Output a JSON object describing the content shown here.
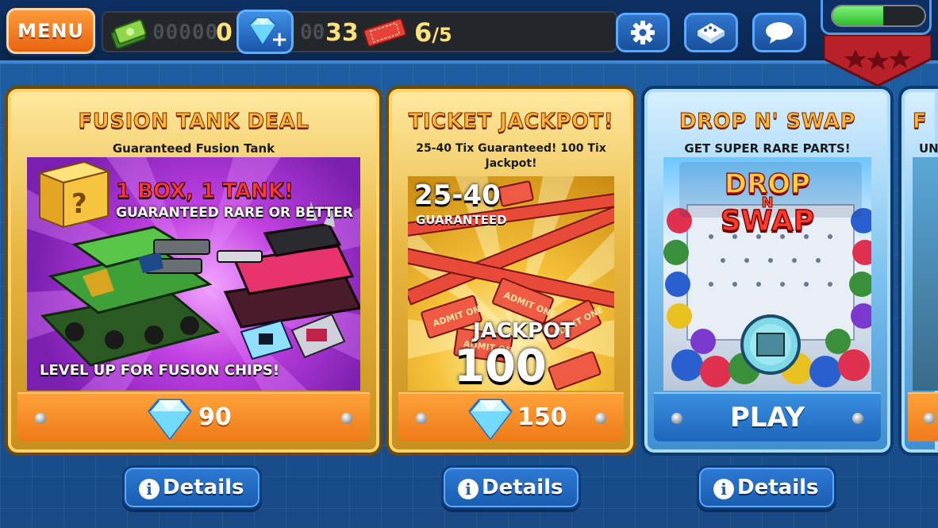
{
  "topbar": {
    "menu_label": "MENU",
    "cash_dim_digits": "00000",
    "cash_value": "0",
    "gems_dim_digits": "00",
    "gems_value": "33",
    "tickets_current": "6",
    "tickets_max": "/5",
    "xp_progress": 0.55,
    "icons": [
      "cash-icon",
      "gem-icon",
      "ticket-icon",
      "settings-gear-icon",
      "tank-garage-icon",
      "chat-bubble-icon",
      "rank-badge-icon"
    ]
  },
  "cards": [
    {
      "title": "FUSION TANK DEAL",
      "subtitle": "Guaranteed Fusion Tank",
      "art_headline": "1 BOX, 1 TANK!",
      "art_subline": "GUARANTEED RARE OR BETTER",
      "art_footer": "LEVEL UP FOR FUSION CHIPS!",
      "price": "90",
      "details_label": "Details"
    },
    {
      "title": "TICKET JACKPOT!",
      "subtitle": "25-40 Tix Guaranteed! 100 Tix Jackpot!",
      "art_range": "25-40",
      "art_guaranteed": "GUARANTEED",
      "art_jackpot": "JACKPOT",
      "art_jackpot_value": "100",
      "ticket_label": "ADMIT ONE",
      "price": "150",
      "details_label": "Details"
    },
    {
      "title": "DROP N' SWAP",
      "subtitle": "GET SUPER RARE PARTS!",
      "art_logo_top": "DROP",
      "art_logo_mid": "N",
      "art_logo_bottom": "SWAP",
      "action_label": "PLAY",
      "details_label": "Details"
    },
    {
      "title": "F",
      "subtitle": "UN"
    }
  ],
  "colors": {
    "gold_card": "#e7b640",
    "blue_card": "#3e8ed0",
    "price_bar": "#ee7b18",
    "play_bar": "#1e66bb",
    "title_orange": "#ffb43a"
  }
}
